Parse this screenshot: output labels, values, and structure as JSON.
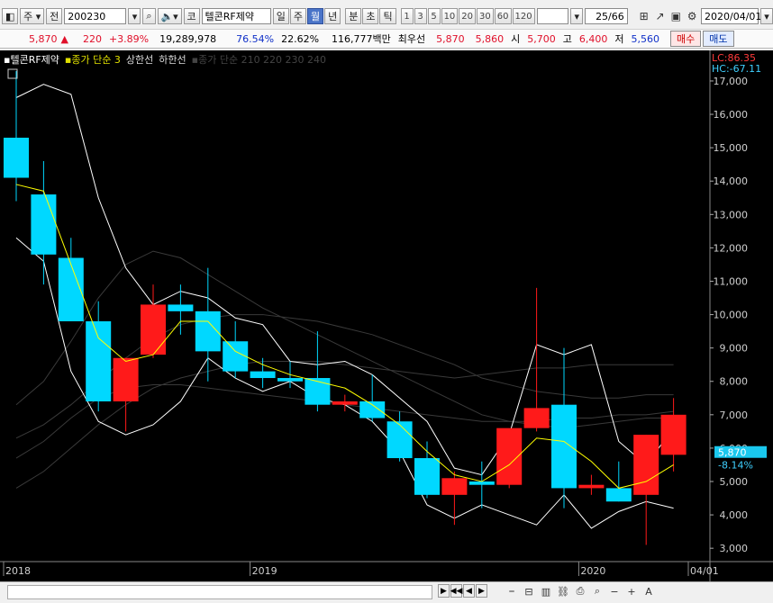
{
  "toolbar": {
    "mode_label": "주",
    "prev_label": "전",
    "code": "200230",
    "market_label": "코",
    "stock_name": "텔콘RF제약",
    "period_tabs": [
      "일",
      "주",
      "월",
      "년"
    ],
    "selected_period": "월",
    "intraday_tabs": [
      "분",
      "초",
      "틱"
    ],
    "number_tabs": [
      "1",
      "3",
      "5",
      "10",
      "20",
      "30",
      "60",
      "120"
    ],
    "page_indicator": "25/66",
    "date": "2020/04/01"
  },
  "quote": {
    "price": "5,870",
    "change": "220",
    "change_pct": "+3.89%",
    "volume": "19,289,978",
    "ratio1": "76.54%",
    "ratio2": "22.62%",
    "amount": "116,777백만",
    "sub_name": "최우선",
    "sell_price": "5,870",
    "buy_price": "5,860",
    "open_label": "시",
    "open": "5,700",
    "high_label": "고",
    "high": "6,400",
    "low_label": "저",
    "low": "5,560",
    "buy_button": "매수",
    "sell_button": "매도"
  },
  "legend": {
    "name": "텔콘RF제약",
    "ma_label": "종가 단순 3",
    "upper_label": "상한선",
    "lower_label": "하한선",
    "ma_long_label": "종가 단순 210 220 230 240"
  },
  "right_axis": {
    "lc": "LC:86.35",
    "hc": "HC:-67.11",
    "current_price": "5,870",
    "current_pct": "-8.14%"
  },
  "colors": {
    "up": "#ff1a1a",
    "down": "#00d8ff",
    "ma": "#ffff00",
    "band": "#ffffff",
    "long_ma": "#3a3a3a"
  },
  "chart_data": {
    "type": "candlestick",
    "ylim": [
      2600,
      17700
    ],
    "yticks": [
      "17,000",
      "16,000",
      "15,000",
      "14,000",
      "13,000",
      "12,000",
      "11,000",
      "10,000",
      "9,000",
      "8,000",
      "7,000",
      "6,000",
      "5,000",
      "4,000",
      "3,000"
    ],
    "ytick_values": [
      17000,
      16000,
      15000,
      14000,
      13000,
      12000,
      11000,
      10000,
      9000,
      8000,
      7000,
      6000,
      5000,
      4000,
      3000
    ],
    "xlabels": [
      {
        "label": "2018",
        "index": 0
      },
      {
        "label": "2019",
        "index": 9
      },
      {
        "label": "2020",
        "index": 21
      },
      {
        "label": "04/01",
        "index": 25
      }
    ],
    "candles": [
      {
        "o": 15300,
        "h": 17300,
        "l": 13400,
        "c": 14100
      },
      {
        "o": 13600,
        "h": 14600,
        "l": 10900,
        "c": 11800
      },
      {
        "o": 11700,
        "h": 12300,
        "l": 9800,
        "c": 9800
      },
      {
        "o": 9800,
        "h": 10400,
        "l": 7100,
        "c": 7400
      },
      {
        "o": 7400,
        "h": 8700,
        "l": 6500,
        "c": 8700
      },
      {
        "o": 8800,
        "h": 10900,
        "l": 8700,
        "c": 10300
      },
      {
        "o": 10300,
        "h": 10900,
        "l": 9400,
        "c": 10100
      },
      {
        "o": 10100,
        "h": 11400,
        "l": 8000,
        "c": 8900
      },
      {
        "o": 9200,
        "h": 9800,
        "l": 8100,
        "c": 8300
      },
      {
        "o": 8300,
        "h": 8700,
        "l": 7800,
        "c": 8100
      },
      {
        "o": 8100,
        "h": 8600,
        "l": 7800,
        "c": 8000
      },
      {
        "o": 8100,
        "h": 9500,
        "l": 7100,
        "c": 7300
      },
      {
        "o": 7300,
        "h": 7600,
        "l": 7100,
        "c": 7400
      },
      {
        "o": 7400,
        "h": 8200,
        "l": 6800,
        "c": 6900
      },
      {
        "o": 6800,
        "h": 7100,
        "l": 5600,
        "c": 5700
      },
      {
        "o": 5700,
        "h": 6200,
        "l": 4500,
        "c": 4600
      },
      {
        "o": 4600,
        "h": 5300,
        "l": 3700,
        "c": 5100
      },
      {
        "o": 5000,
        "h": 5600,
        "l": 4200,
        "c": 4900
      },
      {
        "o": 4900,
        "h": 6500,
        "l": 4800,
        "c": 6600
      },
      {
        "o": 6600,
        "h": 10800,
        "l": 6500,
        "c": 7200
      },
      {
        "o": 7300,
        "h": 9000,
        "l": 4200,
        "c": 4800
      },
      {
        "o": 4800,
        "h": 5200,
        "l": 4600,
        "c": 4900
      },
      {
        "o": 4800,
        "h": 5600,
        "l": 4400,
        "c": 4400
      },
      {
        "o": 4600,
        "h": 6400,
        "l": 3100,
        "c": 6400
      },
      {
        "o": 5800,
        "h": 7500,
        "l": 5300,
        "c": 7000
      }
    ],
    "ma3": [
      13900,
      13700,
      11500,
      9300,
      8600,
      8800,
      9800,
      9800,
      8900,
      8500,
      8200,
      8000,
      7800,
      7300,
      6700,
      5900,
      5200,
      5000,
      5500,
      6300,
      6200,
      5600,
      4800,
      5000,
      5500
    ],
    "upper_band": [
      16500,
      16900,
      16600,
      13500,
      11400,
      10300,
      10700,
      10500,
      9900,
      9700,
      8600,
      8500,
      8600,
      8200,
      7500,
      6800,
      5400,
      5200,
      6400,
      9100,
      8800,
      9100,
      6200,
      5500,
      6600
    ],
    "lower_band": [
      12300,
      11600,
      8300,
      6800,
      6400,
      6700,
      7400,
      8700,
      8100,
      7700,
      8000,
      7500,
      7300,
      6800,
      5900,
      4300,
      3900,
      4300,
      4000,
      3700,
      4600,
      3600,
      4100,
      4400,
      4200
    ],
    "long_ma": [
      [
        4800,
        5300,
        6000,
        6700,
        7300,
        7800,
        8100,
        8300,
        8500,
        8600,
        8600,
        8600,
        8500,
        8400,
        8300,
        8200,
        8100,
        8200,
        8300,
        8400,
        8400,
        8500,
        8500,
        8500,
        8500
      ],
      [
        6300,
        6700,
        7300,
        8000,
        8700,
        9300,
        9700,
        9900,
        10000,
        10000,
        9900,
        9800,
        9600,
        9400,
        9100,
        8800,
        8500,
        8100,
        7900,
        7700,
        7600,
        7500,
        7500,
        7600,
        7600
      ],
      [
        7300,
        8000,
        9200,
        10500,
        11500,
        11900,
        11700,
        11200,
        10700,
        10200,
        9800,
        9400,
        9000,
        8600,
        8200,
        7800,
        7400,
        7000,
        6800,
        6700,
        6600,
        6700,
        6800,
        6900,
        6900
      ],
      [
        5700,
        6200,
        6900,
        7500,
        7800,
        7900,
        7900,
        7800,
        7700,
        7600,
        7500,
        7400,
        7300,
        7200,
        7100,
        7000,
        6900,
        6800,
        6800,
        6800,
        6900,
        6900,
        7000,
        7000,
        7100
      ]
    ]
  }
}
